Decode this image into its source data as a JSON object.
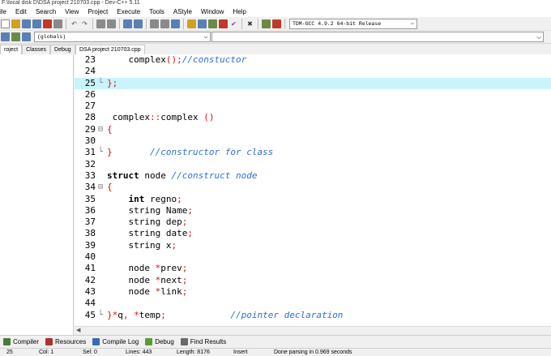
{
  "window": {
    "title": "F:\\local disk D\\DSA project 210703.cpp - Dev-C++ 5.11"
  },
  "menu": [
    "ile",
    "Edit",
    "Search",
    "View",
    "Project",
    "Execute",
    "Tools",
    "AStyle",
    "Window",
    "Help"
  ],
  "toolbar": {
    "compiler": "TDM-GCC 4.9.2 64-bit Release"
  },
  "scope": {
    "value": "(globals)"
  },
  "left_tabs": [
    "roject",
    "Classes",
    "Debug"
  ],
  "editor_tab": "DSA project 210703.cpp",
  "code_lines": [
    {
      "n": "23",
      "fold": "",
      "parts": [
        {
          "t": "    complex",
          "c": ""
        },
        {
          "t": "();",
          "c": "sym"
        },
        {
          "t": "//constuctor",
          "c": "cm"
        }
      ]
    },
    {
      "n": "24",
      "fold": "",
      "parts": []
    },
    {
      "n": "25",
      "fold": "└",
      "hl": true,
      "parts": [
        {
          "t": "};",
          "c": "sym"
        }
      ]
    },
    {
      "n": "26",
      "fold": "",
      "parts": []
    },
    {
      "n": "27",
      "fold": "",
      "parts": []
    },
    {
      "n": "28",
      "fold": "",
      "parts": [
        {
          "t": " complex",
          "c": ""
        },
        {
          "t": "::",
          "c": "sym"
        },
        {
          "t": "complex ",
          "c": ""
        },
        {
          "t": "()",
          "c": "sym"
        }
      ]
    },
    {
      "n": "29",
      "fold": "⊟",
      "parts": [
        {
          "t": "{",
          "c": "sym"
        }
      ]
    },
    {
      "n": "30",
      "fold": "",
      "parts": []
    },
    {
      "n": "31",
      "fold": "└",
      "parts": [
        {
          "t": "}",
          "c": "sym"
        },
        {
          "t": "       //constructor for class",
          "c": "cm"
        }
      ]
    },
    {
      "n": "32",
      "fold": "",
      "parts": []
    },
    {
      "n": "33",
      "fold": "",
      "parts": [
        {
          "t": "struct",
          "c": "kw"
        },
        {
          "t": " node ",
          "c": ""
        },
        {
          "t": "//construct node",
          "c": "cm"
        }
      ]
    },
    {
      "n": "34",
      "fold": "⊟",
      "parts": [
        {
          "t": "{",
          "c": "sym"
        }
      ]
    },
    {
      "n": "35",
      "fold": "",
      "parts": [
        {
          "t": "    ",
          "c": ""
        },
        {
          "t": "int",
          "c": "kw"
        },
        {
          "t": " regno",
          "c": ""
        },
        {
          "t": ";",
          "c": "sym"
        }
      ]
    },
    {
      "n": "36",
      "fold": "",
      "parts": [
        {
          "t": "    string Name",
          "c": ""
        },
        {
          "t": ";",
          "c": "sym"
        }
      ]
    },
    {
      "n": "37",
      "fold": "",
      "parts": [
        {
          "t": "    string dep",
          "c": ""
        },
        {
          "t": ";",
          "c": "sym"
        }
      ]
    },
    {
      "n": "38",
      "fold": "",
      "parts": [
        {
          "t": "    string date",
          "c": ""
        },
        {
          "t": ";",
          "c": "sym"
        }
      ]
    },
    {
      "n": "39",
      "fold": "",
      "parts": [
        {
          "t": "    string x",
          "c": ""
        },
        {
          "t": ";",
          "c": "sym"
        }
      ]
    },
    {
      "n": "40",
      "fold": "",
      "parts": []
    },
    {
      "n": "41",
      "fold": "",
      "parts": [
        {
          "t": "    node ",
          "c": ""
        },
        {
          "t": "*",
          "c": "sym"
        },
        {
          "t": "prev",
          "c": ""
        },
        {
          "t": ";",
          "c": "sym"
        }
      ]
    },
    {
      "n": "42",
      "fold": "",
      "parts": [
        {
          "t": "    node ",
          "c": ""
        },
        {
          "t": "*",
          "c": "sym"
        },
        {
          "t": "next",
          "c": ""
        },
        {
          "t": ";",
          "c": "sym"
        }
      ]
    },
    {
      "n": "43",
      "fold": "",
      "parts": [
        {
          "t": "    node ",
          "c": ""
        },
        {
          "t": "*",
          "c": "sym"
        },
        {
          "t": "link",
          "c": ""
        },
        {
          "t": ";",
          "c": "sym"
        }
      ]
    },
    {
      "n": "44",
      "fold": "",
      "parts": []
    },
    {
      "n": "45",
      "fold": "└",
      "parts": [
        {
          "t": "}",
          "c": "sym"
        },
        {
          "t": "*",
          "c": "sym"
        },
        {
          "t": "q",
          "c": ""
        },
        {
          "t": ", *",
          "c": "sym"
        },
        {
          "t": "temp",
          "c": ""
        },
        {
          "t": ";",
          "c": "sym"
        },
        {
          "t": "            ",
          "c": ""
        },
        {
          "t": "//pointer declaration",
          "c": "cm"
        }
      ]
    }
  ],
  "bottom_tabs": [
    {
      "label": "Compiler",
      "icon": "compiler-icon",
      "color": "#4a7a3a"
    },
    {
      "label": "Resources",
      "icon": "resources-icon",
      "color": "#b03030"
    },
    {
      "label": "Compile Log",
      "icon": "compile-log-icon",
      "color": "#3a6ab0"
    },
    {
      "label": "Debug",
      "icon": "debug-icon",
      "color": "#5a9a3a"
    },
    {
      "label": "Find Results",
      "icon": "find-results-icon",
      "color": "#6a6a6a"
    }
  ],
  "status": {
    "line": "25",
    "col": "Col: 1",
    "sel": "Sel: 0",
    "lines": "Lines: 443",
    "length": "Length: 8176",
    "mode": "Insert",
    "message": "Done parsing in 0.969 seconds"
  }
}
